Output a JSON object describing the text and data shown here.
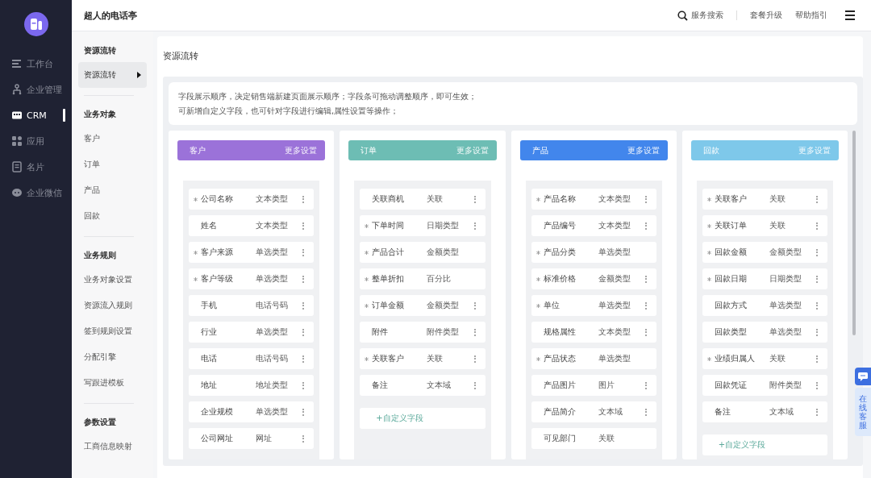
{
  "sidebar": {
    "items": [
      {
        "label": "工作台",
        "selected": false
      },
      {
        "label": "企业管理",
        "selected": false
      },
      {
        "label": "CRM",
        "selected": true
      },
      {
        "label": "应用",
        "selected": false
      },
      {
        "label": "名片",
        "selected": false
      },
      {
        "label": "企业微信",
        "selected": false
      }
    ]
  },
  "topbar": {
    "title": "超人的电话亭",
    "search": "服务搜索",
    "links": [
      "套餐升级",
      "帮助指引"
    ]
  },
  "submenu": {
    "groups": [
      {
        "heading": "资源流转",
        "items": [
          {
            "label": "资源流转",
            "selected": true
          }
        ]
      },
      {
        "heading": "业务对象",
        "items": [
          {
            "label": "客户",
            "selected": false
          },
          {
            "label": "订单",
            "selected": false
          },
          {
            "label": "产品",
            "selected": false
          },
          {
            "label": "回款",
            "selected": false
          }
        ]
      },
      {
        "heading": "业务规则",
        "items": [
          {
            "label": "业务对象设置",
            "selected": false
          },
          {
            "label": "资源流入规则",
            "selected": false
          },
          {
            "label": "签到规则设置",
            "selected": false
          },
          {
            "label": "分配引擎",
            "selected": false
          },
          {
            "label": "写跟进模板",
            "selected": false
          }
        ]
      },
      {
        "heading": "参数设置",
        "items": [
          {
            "label": "工商信息映射",
            "selected": false
          }
        ]
      }
    ]
  },
  "page": {
    "title": "资源流转",
    "notice": [
      "字段展示顺序，决定销售端新建页面展示顺序；字段条可拖动调整顺序，即可生效；",
      "可新增自定义字段，也可针对字段进行编辑,属性设置等操作；"
    ]
  },
  "columns": [
    {
      "title": "客户",
      "more": "更多设置",
      "color": "#9b72d9",
      "fields": [
        {
          "name": "公司名称",
          "type": "文本类型",
          "required": true,
          "menu": true
        },
        {
          "name": "姓名",
          "type": "文本类型",
          "required": false,
          "menu": true
        },
        {
          "name": "客户来源",
          "type": "单选类型",
          "required": true,
          "menu": true
        },
        {
          "name": "客户等级",
          "type": "单选类型",
          "required": true,
          "menu": true
        },
        {
          "name": "手机",
          "type": "电话号码",
          "required": false,
          "menu": true
        },
        {
          "name": "行业",
          "type": "单选类型",
          "required": false,
          "menu": true
        },
        {
          "name": "电话",
          "type": "电话号码",
          "required": false,
          "menu": true
        },
        {
          "name": "地址",
          "type": "地址类型",
          "required": false,
          "menu": true
        },
        {
          "name": "企业规模",
          "type": "单选类型",
          "required": false,
          "menu": true
        },
        {
          "name": "公司网址",
          "type": "网址",
          "required": false,
          "menu": true
        }
      ]
    },
    {
      "title": "订单",
      "more": "更多设置",
      "color": "#6dbdb4",
      "add_field": "+自定义字段",
      "fields": [
        {
          "name": "关联商机",
          "type": "关联",
          "required": false,
          "menu": true
        },
        {
          "name": "下单时间",
          "type": "日期类型",
          "required": true,
          "menu": true
        },
        {
          "name": "产品合计",
          "type": "金额类型",
          "required": true,
          "menu": false
        },
        {
          "name": "整单折扣",
          "type": "百分比",
          "required": true,
          "menu": false
        },
        {
          "name": "订单金额",
          "type": "金额类型",
          "required": true,
          "menu": true
        },
        {
          "name": "附件",
          "type": "附件类型",
          "required": false,
          "menu": true
        },
        {
          "name": "关联客户",
          "type": "关联",
          "required": true,
          "menu": true
        },
        {
          "name": "备注",
          "type": "文本域",
          "required": false,
          "menu": true
        }
      ]
    },
    {
      "title": "产品",
      "more": "更多设置",
      "color": "#4286ec",
      "fields": [
        {
          "name": "产品名称",
          "type": "文本类型",
          "required": true,
          "menu": true
        },
        {
          "name": "产品编号",
          "type": "文本类型",
          "required": false,
          "menu": true
        },
        {
          "name": "产品分类",
          "type": "单选类型",
          "required": true,
          "menu": false
        },
        {
          "name": "标准价格",
          "type": "金额类型",
          "required": true,
          "menu": true
        },
        {
          "name": "单位",
          "type": "单选类型",
          "required": true,
          "menu": true
        },
        {
          "name": "规格属性",
          "type": "文本类型",
          "required": false,
          "menu": true
        },
        {
          "name": "产品状态",
          "type": "单选类型",
          "required": true,
          "menu": false
        },
        {
          "name": "产品图片",
          "type": "图片",
          "required": false,
          "menu": true
        },
        {
          "name": "产品简介",
          "type": "文本域",
          "required": false,
          "menu": true
        },
        {
          "name": "可见部门",
          "type": "关联",
          "required": false,
          "menu": false
        }
      ]
    },
    {
      "title": "回款",
      "more": "更多设置",
      "color": "#7ec8ea",
      "add_field": "+自定义字段",
      "fields": [
        {
          "name": "关联客户",
          "type": "关联",
          "required": true,
          "menu": true
        },
        {
          "name": "关联订单",
          "type": "关联",
          "required": true,
          "menu": true
        },
        {
          "name": "回款金额",
          "type": "金额类型",
          "required": true,
          "menu": true
        },
        {
          "name": "回款日期",
          "type": "日期类型",
          "required": true,
          "menu": true
        },
        {
          "name": "回款方式",
          "type": "单选类型",
          "required": false,
          "menu": true
        },
        {
          "name": "回款类型",
          "type": "单选类型",
          "required": false,
          "menu": true
        },
        {
          "name": "业绩归属人",
          "type": "关联",
          "required": true,
          "menu": true
        },
        {
          "name": "回款凭证",
          "type": "附件类型",
          "required": false,
          "menu": true
        },
        {
          "name": "备注",
          "type": "文本域",
          "required": false,
          "menu": true
        }
      ]
    }
  ],
  "support": {
    "label": "在线客服"
  }
}
